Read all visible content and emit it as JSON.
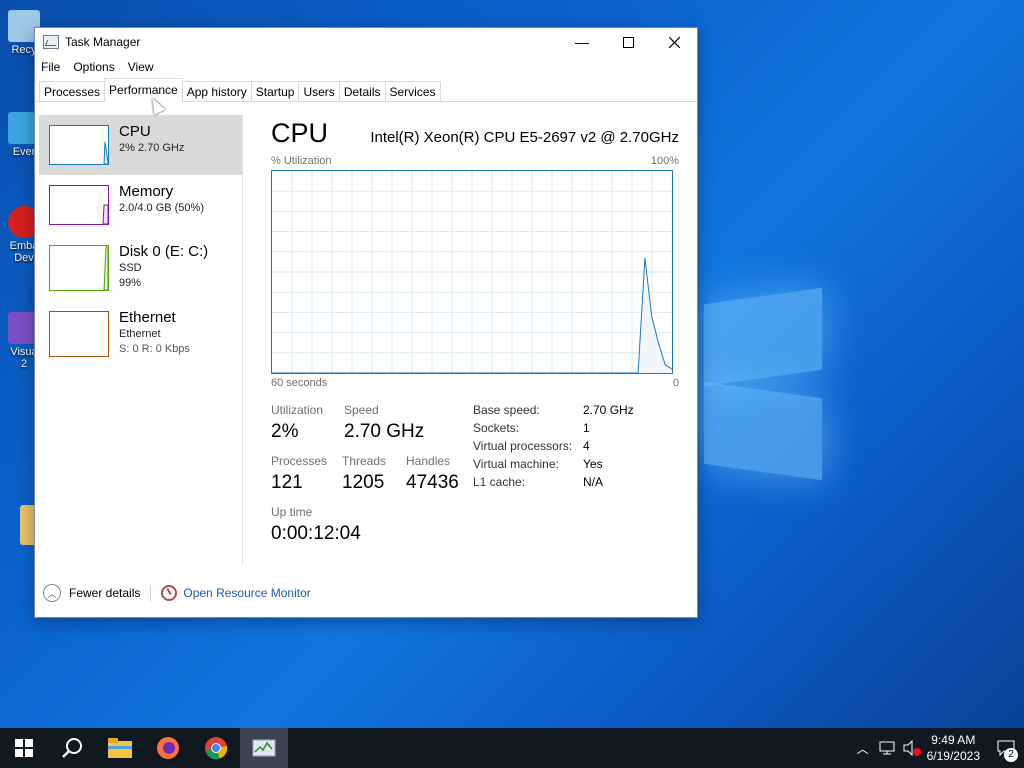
{
  "desktop": {
    "icons": [
      {
        "label": "Recy",
        "color": "#9ec9e8"
      },
      {
        "label": "Ever",
        "color": "#3aa5e0"
      },
      {
        "label": "Emba\nDev",
        "color": "#d82020"
      },
      {
        "label": "Visua\n2",
        "color": "#7d4fc5"
      }
    ]
  },
  "window": {
    "title": "Task Manager",
    "controls": {
      "minimize": "—",
      "maximize": "☐",
      "close": "✕"
    },
    "menu": [
      "File",
      "Options",
      "View"
    ],
    "tabs": [
      "Processes",
      "Performance",
      "App history",
      "Startup",
      "Users",
      "Details",
      "Services"
    ],
    "active_tab": "Performance"
  },
  "resources": [
    {
      "title": "CPU",
      "sub1": "2% 2.70 GHz",
      "sub2": "",
      "sub3": "",
      "color": "#117dbb",
      "fill": 0.15
    },
    {
      "title": "Memory",
      "sub1": "2.0/4.0 GB (50%)",
      "sub2": "",
      "sub3": "",
      "color": "#8b12ae",
      "fill": 0.5
    },
    {
      "title": "Disk 0 (E: C:)",
      "sub1": "SSD",
      "sub2": "99%",
      "sub3": "",
      "color": "#4da60c",
      "fill": 0.99
    },
    {
      "title": "Ethernet",
      "sub1": "Ethernet",
      "sub2": "S: 0 R: 0 Kbps",
      "sub3": "",
      "color": "#a74f01",
      "fill": 0
    }
  ],
  "cpu_panel": {
    "title": "CPU",
    "model": "Intel(R) Xeon(R) CPU E5-2697 v2 @ 2.70GHz",
    "graph_label_left": "% Utilization",
    "graph_label_right": "100%",
    "graph_bottom_left": "60 seconds",
    "graph_bottom_right": "0",
    "utilization_history": [
      0,
      0,
      0,
      0,
      0,
      0,
      0,
      0,
      0,
      0,
      0,
      0,
      0,
      0,
      0,
      0,
      0,
      0,
      0,
      0,
      0,
      0,
      0,
      0,
      0,
      0,
      0,
      0,
      0,
      0,
      0,
      0,
      0,
      0,
      0,
      0,
      0,
      0,
      0,
      0,
      0,
      0,
      0,
      0,
      0,
      0,
      0,
      0,
      0,
      0,
      0,
      0,
      0,
      0,
      0,
      57,
      28,
      15,
      4,
      2
    ],
    "stats": {
      "utilization_label": "Utilization",
      "utilization_value": "2%",
      "speed_label": "Speed",
      "speed_value": "2.70 GHz",
      "processes_label": "Processes",
      "processes_value": "121",
      "threads_label": "Threads",
      "threads_value": "1205",
      "handles_label": "Handles",
      "handles_value": "47436",
      "uptime_label": "Up time",
      "uptime_value": "0:00:12:04"
    },
    "specs": [
      {
        "label": "Base speed:",
        "value": "2.70 GHz"
      },
      {
        "label": "Sockets:",
        "value": "1"
      },
      {
        "label": "Virtual processors:",
        "value": "4"
      },
      {
        "label": "Virtual machine:",
        "value": "Yes"
      },
      {
        "label": "L1 cache:",
        "value": "N/A"
      }
    ]
  },
  "footer": {
    "fewer_details": "Fewer details",
    "resource_monitor": "Open Resource Monitor"
  },
  "taskbar": {
    "time": "9:49 AM",
    "date": "6/19/2023",
    "notification_count": "2"
  }
}
